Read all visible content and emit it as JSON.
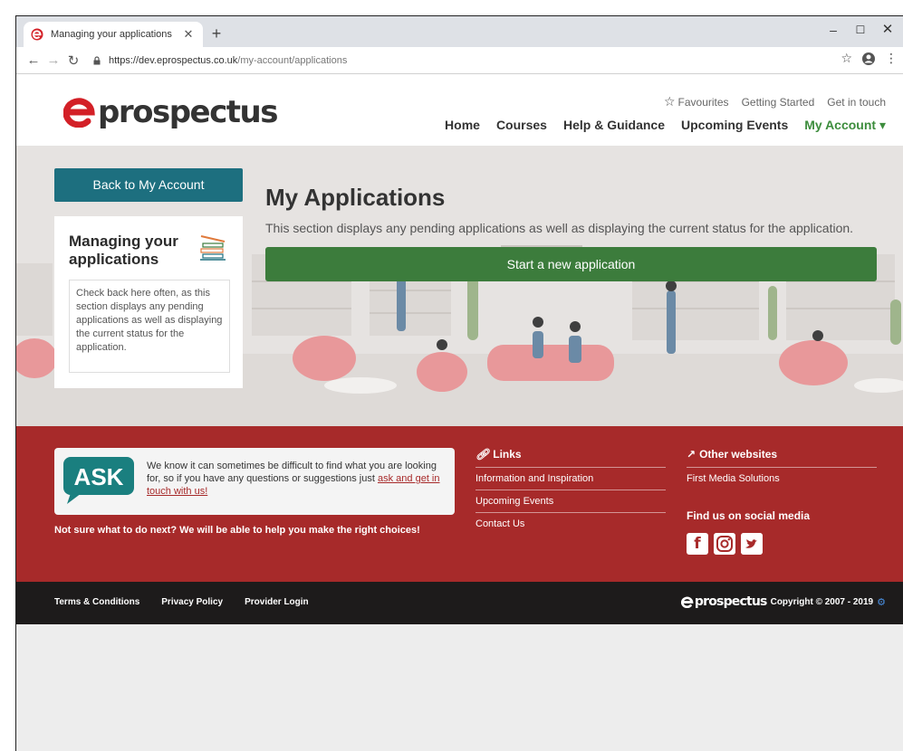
{
  "browser": {
    "tab_title": "Managing your applications",
    "url_host": "https://dev.eprospectus.co.uk",
    "url_path": "/my-account/applications"
  },
  "header": {
    "logo_text": "prospectus",
    "toplinks": {
      "favourites": "Favourites",
      "getting_started": "Getting Started",
      "get_in_touch": "Get in touch"
    },
    "nav": {
      "home": "Home",
      "courses": "Courses",
      "help": "Help & Guidance",
      "events": "Upcoming Events",
      "account": "My Account ▾"
    }
  },
  "sidebar": {
    "back_label": "Back to My Account",
    "card_title": "Managing your applications",
    "card_text": "Check back here often, as this section displays any pending applications as well as displaying the current status for the application."
  },
  "main": {
    "title": "My Applications",
    "description": "This section displays any pending applications as well as displaying the current status for the application.",
    "start_button": "Start a new application"
  },
  "footer": {
    "ask_label": "ASK",
    "ask_text": "We know it can sometimes be difficult to find what you are looking for, so if you have any questions or suggestions just",
    "ask_link": "ask and get in touch with us!",
    "not_sure": "Not sure what to do next? We will be able to help you make the right choices!",
    "links_head": "Links",
    "links": [
      "Information and Inspiration",
      "Upcoming Events",
      "Contact Us"
    ],
    "other_head": "Other websites",
    "other_links": [
      "First Media Solutions"
    ],
    "social_head": "Find us on social media",
    "legal": {
      "terms": "Terms & Conditions",
      "privacy": "Privacy Policy",
      "provider": "Provider Login"
    },
    "copyright_logo": "prospectus",
    "copyright": "Copyright © 2007 - 2019"
  },
  "colors": {
    "brand_red": "#a72a2a",
    "teal": "#1d6f7f",
    "green": "#3c7c3c",
    "accent_green": "#3d8d3d"
  }
}
